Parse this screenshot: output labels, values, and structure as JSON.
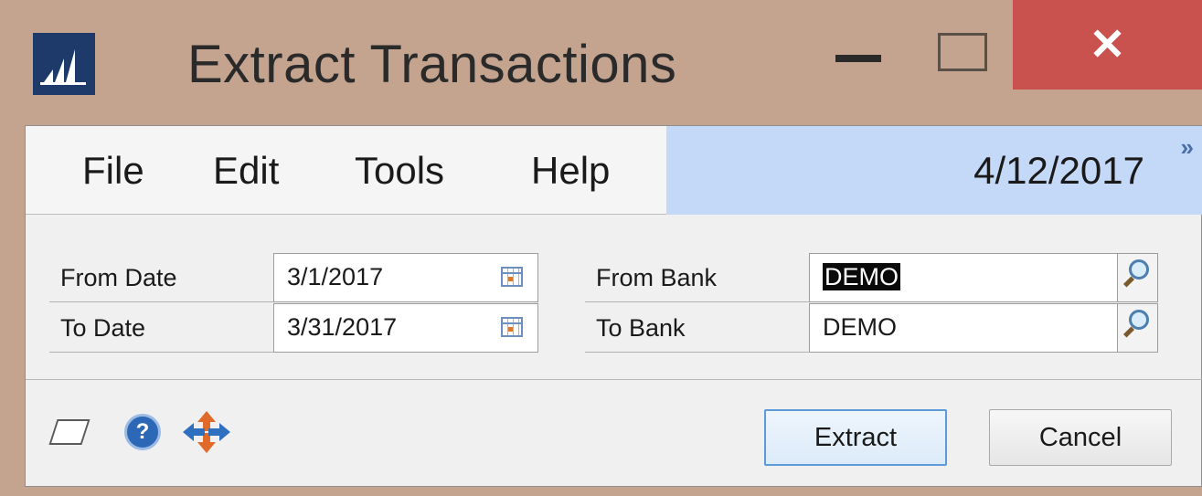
{
  "window": {
    "title": "Extract Transactions",
    "close_glyph": "✕"
  },
  "menu": {
    "items": [
      "File",
      "Edit",
      "Tools",
      "Help"
    ],
    "user_date": "4/12/2017",
    "expand_glyph": "»"
  },
  "form": {
    "from_date": {
      "label": "From Date",
      "value": "3/1/2017"
    },
    "to_date": {
      "label": "To Date",
      "value": "3/31/2017"
    },
    "from_bank": {
      "label": "From Bank",
      "value": "DEMO"
    },
    "to_bank": {
      "label": "To Bank",
      "value": "DEMO"
    }
  },
  "toolbar": {
    "help_glyph": "?",
    "extract_label": "Extract",
    "cancel_label": "Cancel"
  },
  "colors": {
    "window_frame": "#c4a48f",
    "close_button": "#c9524f",
    "date_bar": "#c4d8f8",
    "default_button_border": "#5d9ad8"
  },
  "icons": [
    "dynamics-logo-icon",
    "minimize-icon",
    "maximize-icon",
    "close-icon",
    "calendar-icon",
    "lookup-icon",
    "note-icon",
    "help-icon",
    "sync-icon"
  ]
}
